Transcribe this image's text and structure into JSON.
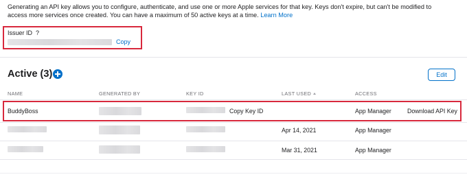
{
  "intro": {
    "text": "Generating an API key allows you to configure, authenticate, and use one or more Apple services for that key. Keys don't expire, but can't be modified to access more services once created. You can have a maximum of 50 active keys at a time.",
    "learn_more": "Learn More"
  },
  "issuer": {
    "label": "Issuer ID",
    "help": "?",
    "copy": "Copy"
  },
  "active": {
    "title": "Active (3)",
    "edit": "Edit"
  },
  "table": {
    "headers": {
      "name": "NAME",
      "generated_by": "GENERATED BY",
      "key_id": "KEY ID",
      "last_used": "LAST USED",
      "access": "ACCESS"
    },
    "rows": [
      {
        "name": "BuddyBoss",
        "copy_key_id": "Copy Key ID",
        "last_used": "",
        "access": "App Manager",
        "download": "Download API Key"
      },
      {
        "name": "",
        "copy_key_id": "",
        "last_used": "Apr 14, 2021",
        "access": "App Manager",
        "download": ""
      },
      {
        "name": "",
        "copy_key_id": "",
        "last_used": "Mar 31, 2021",
        "access": "App Manager",
        "download": ""
      }
    ]
  },
  "colors": {
    "accent": "#0070c9",
    "highlight": "#d8283c",
    "text": "#1d1d1f",
    "muted": "#6e6e73"
  }
}
